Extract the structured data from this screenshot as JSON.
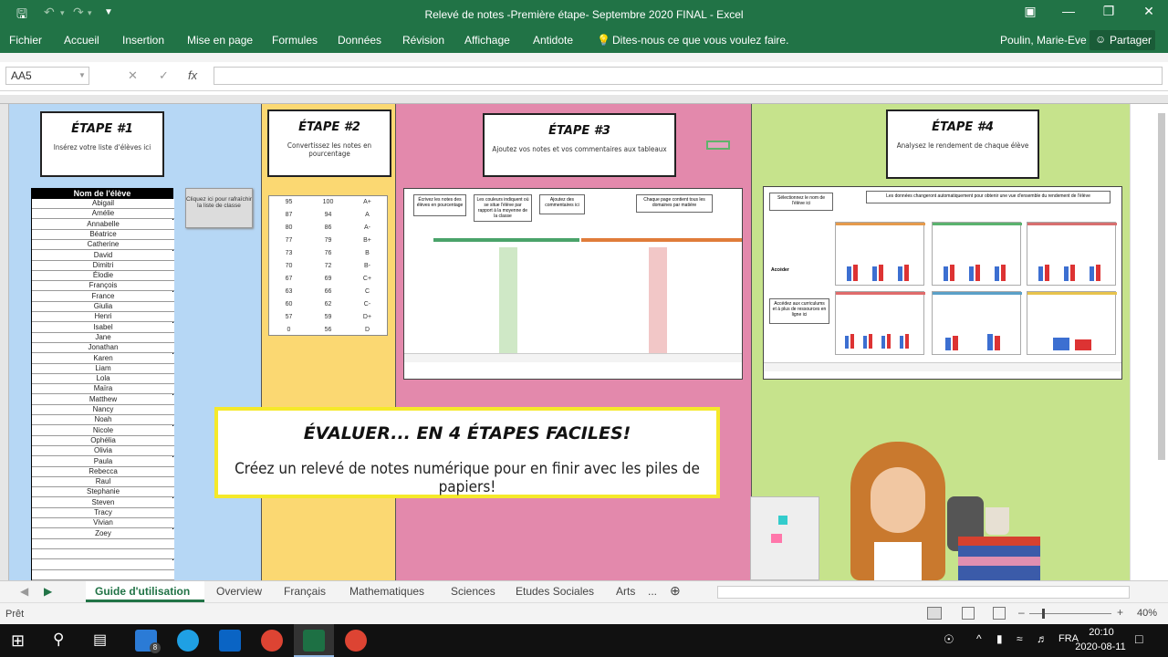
{
  "window": {
    "title": "Relevé de notes -Première étape- Septembre 2020 FINAL - Excel"
  },
  "ribbon_tabs": [
    "Fichier",
    "Accueil",
    "Insertion",
    "Mise en page",
    "Formules",
    "Données",
    "Révision",
    "Affichage",
    "Antidote"
  ],
  "tell_me": "Dites-nous ce que vous voulez faire.",
  "user": "Poulin, Marie-Eve",
  "share_label": "Partager",
  "namebox": "AA5",
  "fx_label": "fx",
  "steps": [
    {
      "title": "ÉTAPE #1",
      "desc": "Insérez votre liste d'élèves ici"
    },
    {
      "title": "ÉTAPE #2",
      "desc": "Convertissez les notes en pourcentage"
    },
    {
      "title": "ÉTAPE #3",
      "desc": "Ajoutez vos notes et vos commentaires aux tableaux"
    },
    {
      "title": "ÉTAPE #4",
      "desc": "Analysez le rendement de chaque élève"
    }
  ],
  "student_header": "Nom de l'élève",
  "refresh_button": "Cliquez ici pour rafraîchir la liste de classe",
  "students": [
    "Abigail",
    "Amélie",
    "Annabelle",
    "Béatrice",
    "Catherine",
    "David",
    "Dimitri",
    "Élodie",
    "François",
    "France",
    "Giulia",
    "Henri",
    "Isabel",
    "Jane",
    "Jonathan",
    "Karen",
    "Liam",
    "Lola",
    "Maïra",
    "Matthew",
    "Nancy",
    "Noah",
    "Nicole",
    "Ophélia",
    "Olivia",
    "Paula",
    "Rebecca",
    "Raul",
    "Stephanie",
    "Steven",
    "Tracy",
    "Vivian",
    "Zoey",
    "",
    "",
    "",
    ""
  ],
  "grades": [
    [
      "95",
      "100",
      "A+"
    ],
    [
      "87",
      "94",
      "A"
    ],
    [
      "80",
      "86",
      "A-"
    ],
    [
      "77",
      "79",
      "B+"
    ],
    [
      "73",
      "76",
      "B"
    ],
    [
      "70",
      "72",
      "B-"
    ],
    [
      "67",
      "69",
      "C+"
    ],
    [
      "63",
      "66",
      "C"
    ],
    [
      "60",
      "62",
      "C-"
    ],
    [
      "57",
      "59",
      "D+"
    ],
    [
      "0",
      "56",
      "D"
    ]
  ],
  "step3_callouts": [
    "Écrivez les notes des élèves en pourcentage",
    "Les couleurs indiquent où se situe l'élève par rapport à la moyenne de la classe",
    "Ajoutez des commentaires ici",
    "Chaque page contient tous les domaines par matière"
  ],
  "step4_callouts": [
    "Sélectionnez le nom de l'élève ici",
    "Les données changeront automatiquement pour obtenir une vue d'ensemble du rendement de l'élève",
    "Accédez aux curriculums et à plus de ressources en ligne ici"
  ],
  "step4_access": "Accéder",
  "banner": {
    "title": "ÉVALUER... EN 4 ÉTAPES FACILES!",
    "subtitle": "Créez un relevé de notes numérique pour en finir avec les piles de papiers!"
  },
  "sheet_tabs": [
    "Guide d'utilisation",
    "Overview",
    "Français",
    "Mathematiques",
    "Sciences",
    "Etudes Sociales",
    "Arts",
    "..."
  ],
  "status": {
    "ready": "Prêt",
    "zoom": "40%"
  },
  "taskbar": {
    "lang": "FRA",
    "time": "20:10",
    "date": "2020-08-11",
    "mail_badge": "8"
  }
}
